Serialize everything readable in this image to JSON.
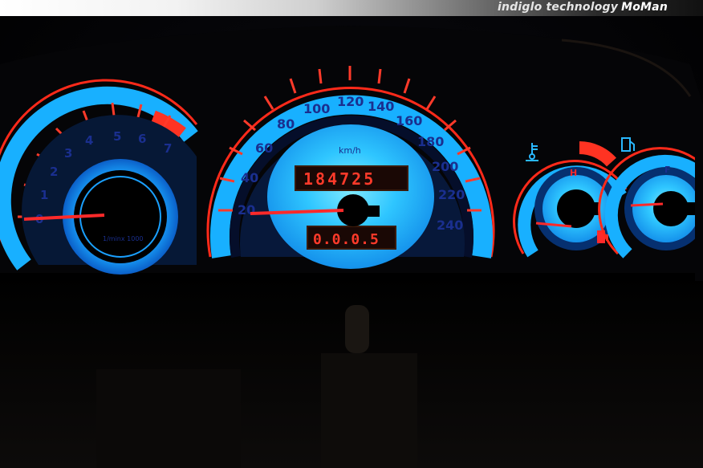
{
  "banner": {
    "text": "indiglo technology",
    "brand": "MoMan"
  },
  "tachometer": {
    "ticks": [
      "0",
      "1",
      "2",
      "3",
      "4",
      "5",
      "6",
      "7"
    ],
    "unit": "1/minx 1000"
  },
  "speedometer": {
    "ticks": [
      "20",
      "40",
      "60",
      "80",
      "100",
      "120",
      "140",
      "160",
      "180",
      "200",
      "220",
      "240"
    ],
    "unit": "km/h",
    "odometer": "184725",
    "trip": "0.0.0.5"
  },
  "temperature_gauge": {
    "high_label": "H"
  },
  "fuel_gauge": {
    "full_label": "F"
  },
  "colors": {
    "gauge_face": "#21b8ff",
    "dial_text": "#1a2f8f",
    "accent_red": "#ff2a1a",
    "background": "#000000"
  }
}
